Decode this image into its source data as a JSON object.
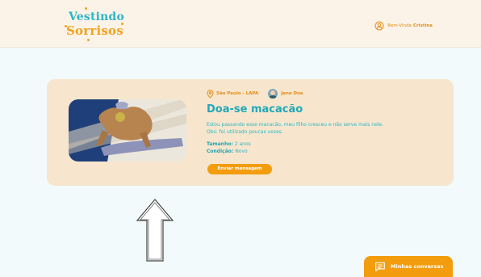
{
  "header": {
    "logo_line1": "Vestindo",
    "logo_line2": "Sorrisos",
    "greeting": "Bem-Vinda",
    "user_name": "Cristina",
    "icons": {
      "user": "user-circle-icon"
    }
  },
  "listing": {
    "location": "São Paulo - LAPA",
    "donor_name": "Jane Doe",
    "title": "Doa-se macacão",
    "description": "Estou passando esse macacão, meu filho cresceu e não serve mais nele. Obs: foi utilizado poucas vezes.",
    "size_label": "Tamanho:",
    "size_value": "2 anos",
    "condition_label": "Condição:",
    "condition_value": "Novo",
    "message_button": "Enviar mensagem",
    "icons": {
      "location": "location-pin-icon",
      "avatar": "avatar"
    }
  },
  "chat": {
    "button_label": "Minhas conversas",
    "icon": "chat-bubble-icon"
  },
  "colors": {
    "accent_orange": "#f39c0d",
    "accent_teal": "#21a8b8",
    "card_bg": "#f7e6cd",
    "header_bg": "#fbf3e8",
    "page_bg": "#f3fafb"
  }
}
